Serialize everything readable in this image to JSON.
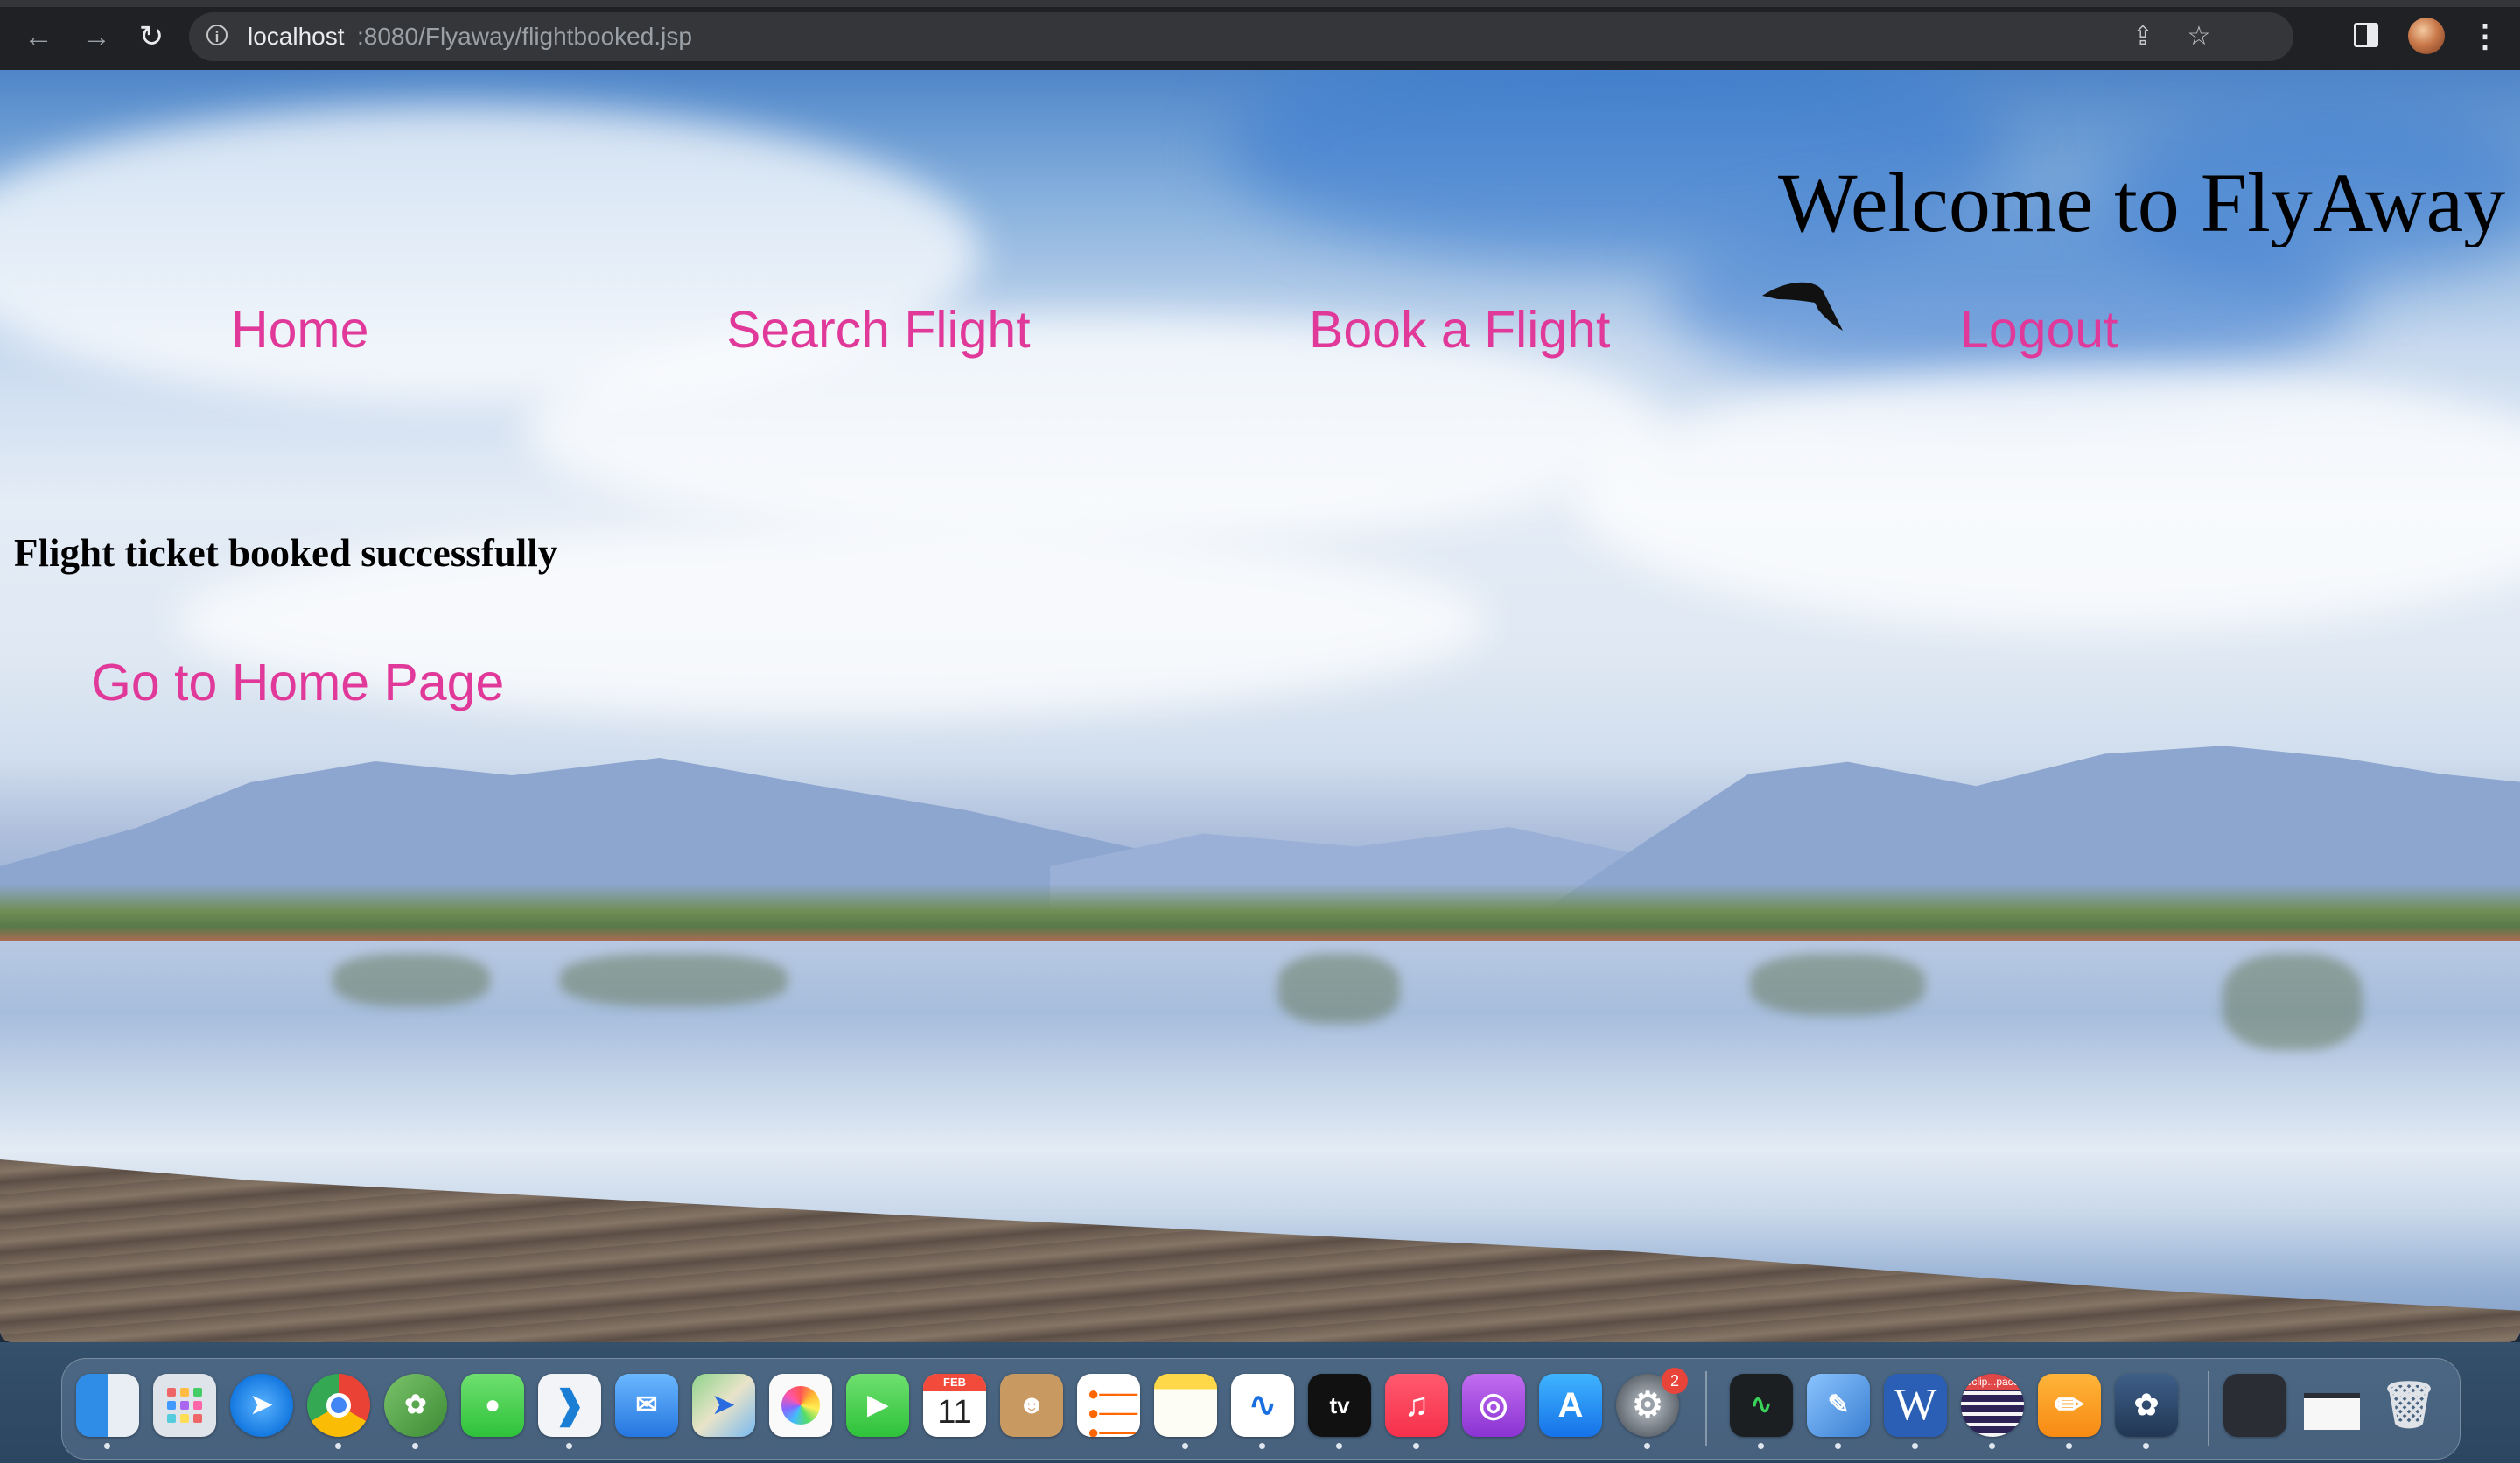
{
  "browser": {
    "url_host": "localhost",
    "url_path": ":8080/Flyaway/flightbooked.jsp",
    "icons": [
      "back-icon",
      "forward-icon",
      "reload-icon",
      "info-icon",
      "share-icon",
      "star-icon",
      "side-panel-icon",
      "profile-avatar",
      "menu-icon"
    ]
  },
  "page": {
    "welcome": "Welcome to FlyAway",
    "nav": {
      "home": "Home",
      "search": "Search Flight",
      "book": "Book a Flight",
      "logout": "Logout"
    },
    "message": "Flight ticket booked successfully",
    "home_link": "Go to Home Page",
    "link_color": "#e0399a"
  },
  "dock": {
    "calendar_month": "FEB",
    "calendar_day": "11",
    "settings_badge": "2",
    "tv_label": "tv",
    "word_label": "W",
    "eclipse_label": "eclip...pace",
    "apps": [
      "finder",
      "launchpad",
      "safari",
      "chrome",
      "spring-tool-suite",
      "messages",
      "vscode",
      "mail",
      "maps",
      "photos",
      "facetime",
      "calendar",
      "contacts",
      "reminders",
      "notes",
      "freeform",
      "apple-tv",
      "music",
      "podcasts",
      "app-store",
      "system-settings",
      "activity-monitor",
      "preview",
      "word",
      "eclipse",
      "pages",
      "mysql-workbench",
      "screenshot-window",
      "window-thumbnail",
      "trash"
    ]
  }
}
